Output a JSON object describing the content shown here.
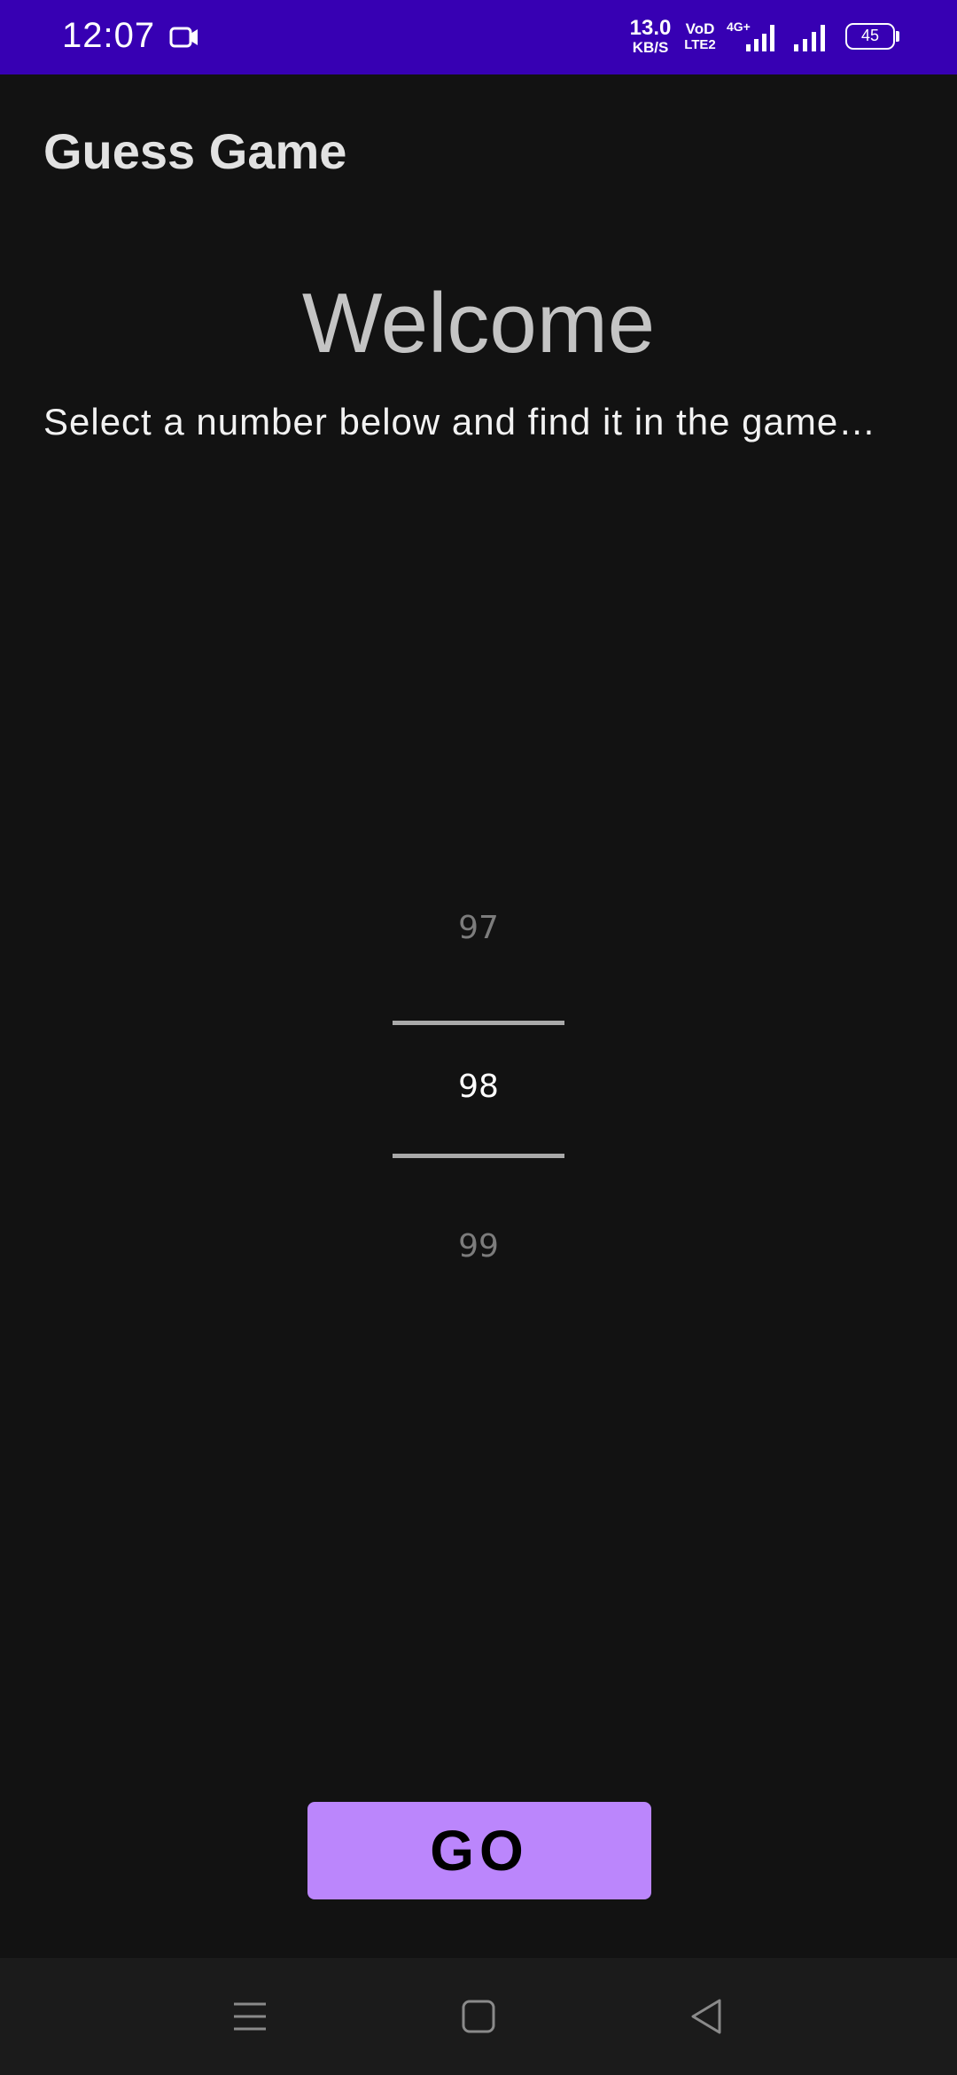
{
  "status_bar": {
    "time": "12:07",
    "net_speed_value": "13.0",
    "net_speed_unit": "KB/S",
    "volte_top": "VoD",
    "volte_bottom": "LTE2",
    "network_label": "4G+",
    "battery_level": "45",
    "icons": [
      "camera-icon",
      "signal-4g-icon",
      "signal-icon",
      "battery-icon"
    ],
    "background_color": "#3700b3"
  },
  "app_bar": {
    "title": "Guess Game"
  },
  "main": {
    "heading": "Welcome",
    "subtitle": "Select a number below and find it in the game…"
  },
  "picker": {
    "previous": "97",
    "selected": "98",
    "next": "99"
  },
  "go_button": {
    "label": "GO",
    "color": "#bb86fc"
  },
  "nav_bar": {
    "icons": [
      "menu-icon",
      "home-icon",
      "back-icon"
    ]
  }
}
